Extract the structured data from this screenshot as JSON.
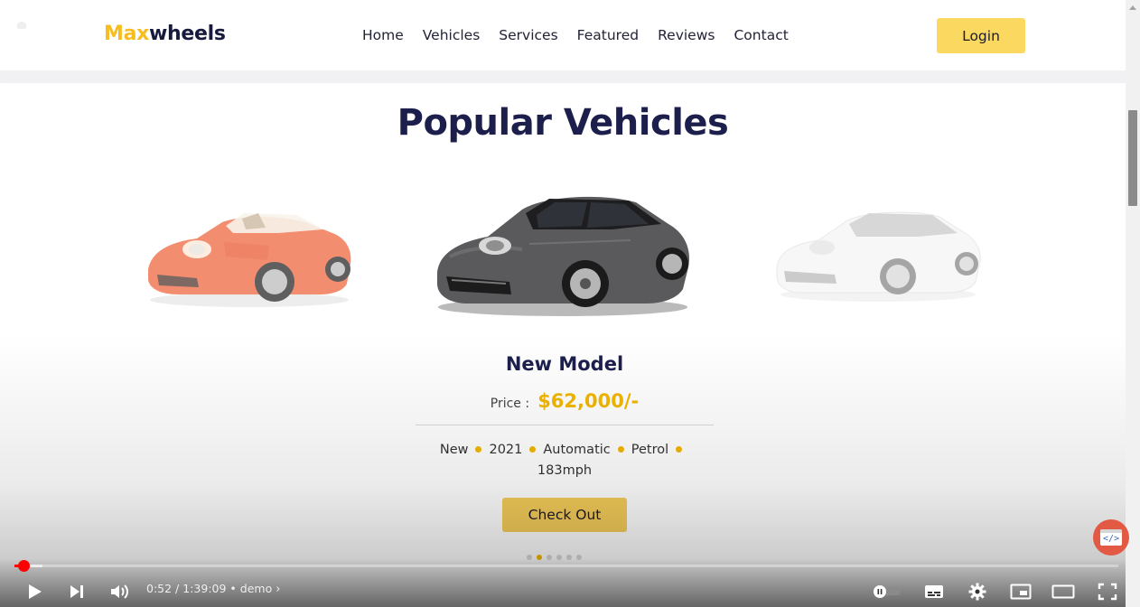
{
  "brand": {
    "prefix": "Max",
    "suffix": "wheels"
  },
  "nav": {
    "items": [
      "Home",
      "Vehicles",
      "Services",
      "Featured",
      "Reviews",
      "Contact"
    ],
    "login_label": "Login"
  },
  "section": {
    "title_plain": "Popular",
    "title_highlight": "Vehicles"
  },
  "carousel": {
    "cars": [
      {
        "color": "orange-red convertible"
      },
      {
        "color": "dark grey sedan"
      },
      {
        "color": "white sedan"
      }
    ],
    "active_index": 1,
    "card": {
      "model": "New Model",
      "price_label": "Price :",
      "price_value": "$62,000/-",
      "specs": [
        "New",
        "2021",
        "Automatic",
        "Petrol",
        "183mph"
      ],
      "cta_label": "Check Out"
    },
    "pager": {
      "count": 6,
      "active": 1
    }
  },
  "colors": {
    "accent": "#f7bd1e",
    "navy": "#1c1f4c",
    "button": "#fbd860",
    "youtube_red": "#ff0000"
  },
  "player": {
    "time_current": "0:52",
    "time_total": "1:39:09",
    "chapter": "demo",
    "progress_fraction": 0.0087,
    "buffered_fraction": 0.025,
    "icons": [
      "play-icon",
      "next-icon",
      "volume-icon",
      "autoplay-toggle-icon",
      "subtitles-icon",
      "settings-icon",
      "miniplayer-icon",
      "theater-icon",
      "fullscreen-icon"
    ]
  }
}
